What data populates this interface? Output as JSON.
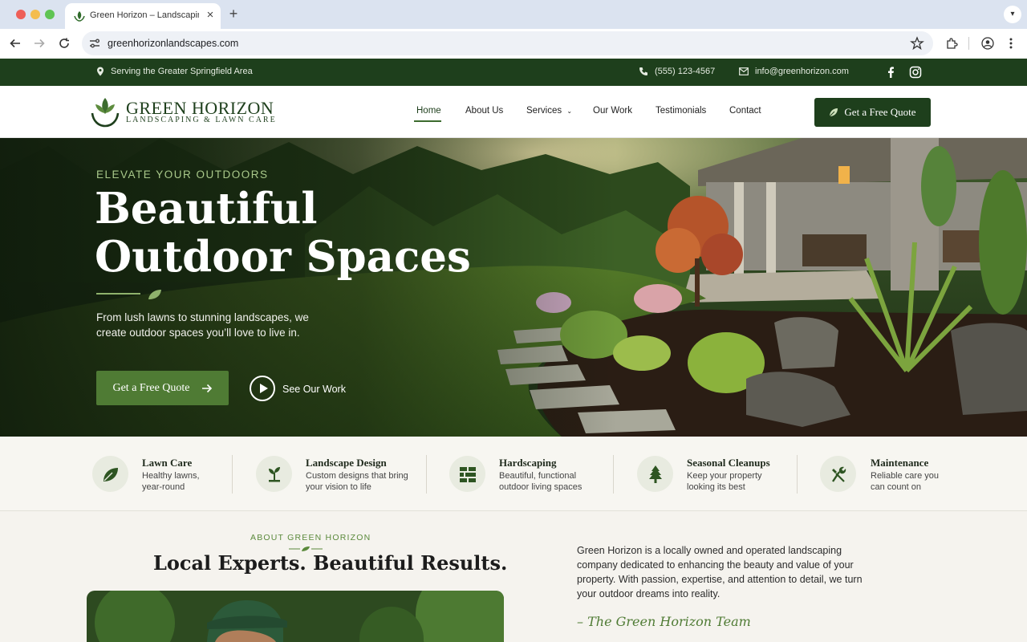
{
  "browser": {
    "tab_title": "Green Horizon – Landscaping &",
    "url": "greenhorizonlandscapes.com"
  },
  "topbar": {
    "location": "Serving the Greater Springfield Area",
    "phone": "(555) 123-4567",
    "email": "info@greenhorizon.com",
    "social": [
      "facebook-icon",
      "instagram-icon"
    ]
  },
  "header": {
    "logo_name": "GREEN HORIZON",
    "logo_tagline": "LANDSCAPING & LAWN CARE",
    "nav": [
      {
        "label": "Home",
        "active": true
      },
      {
        "label": "About Us"
      },
      {
        "label": "Services",
        "dropdown": true
      },
      {
        "label": "Our Work"
      },
      {
        "label": "Testimonials"
      },
      {
        "label": "Contact"
      }
    ],
    "cta": "Get a Free Quote"
  },
  "hero": {
    "eyebrow": "ELEVATE YOUR OUTDOORS",
    "title_line1": "Beautiful",
    "title_line2": "Outdoor Spaces",
    "subtitle": "From lush lawns to stunning landscapes, we create outdoor spaces you’ll love to live in.",
    "cta_primary": "Get a Free Quote",
    "cta_secondary": "See Our Work"
  },
  "services": [
    {
      "icon": "leaf-icon",
      "title": "Lawn Care",
      "desc": "Healthy lawns, year-round"
    },
    {
      "icon": "sprout-icon",
      "title": "Landscape Design",
      "desc": "Custom designs that bring your vision to life"
    },
    {
      "icon": "bricks-icon",
      "title": "Hardscaping",
      "desc": "Beautiful, functional outdoor living spaces"
    },
    {
      "icon": "tree-icon",
      "title": "Seasonal Cleanups",
      "desc": "Keep your property looking its best"
    },
    {
      "icon": "tools-icon",
      "title": "Maintenance",
      "desc": "Reliable care you can count on"
    }
  ],
  "about": {
    "eyebrow": "ABOUT GREEN HORIZON",
    "title": "Local Experts. Beautiful Results.",
    "text": "Green Horizon is a locally owned and operated landscaping company dedicated to enhancing the beauty and value of your property. With passion, expertise, and attention to detail, we turn your outdoor dreams into reality.",
    "signature": "– The Green Horizon Team"
  },
  "colors": {
    "brand_dark": "#1e3f1c",
    "brand_green": "#4f7b34",
    "accent_light": "#a9c98a",
    "page_bg": "#f5f3ee"
  }
}
